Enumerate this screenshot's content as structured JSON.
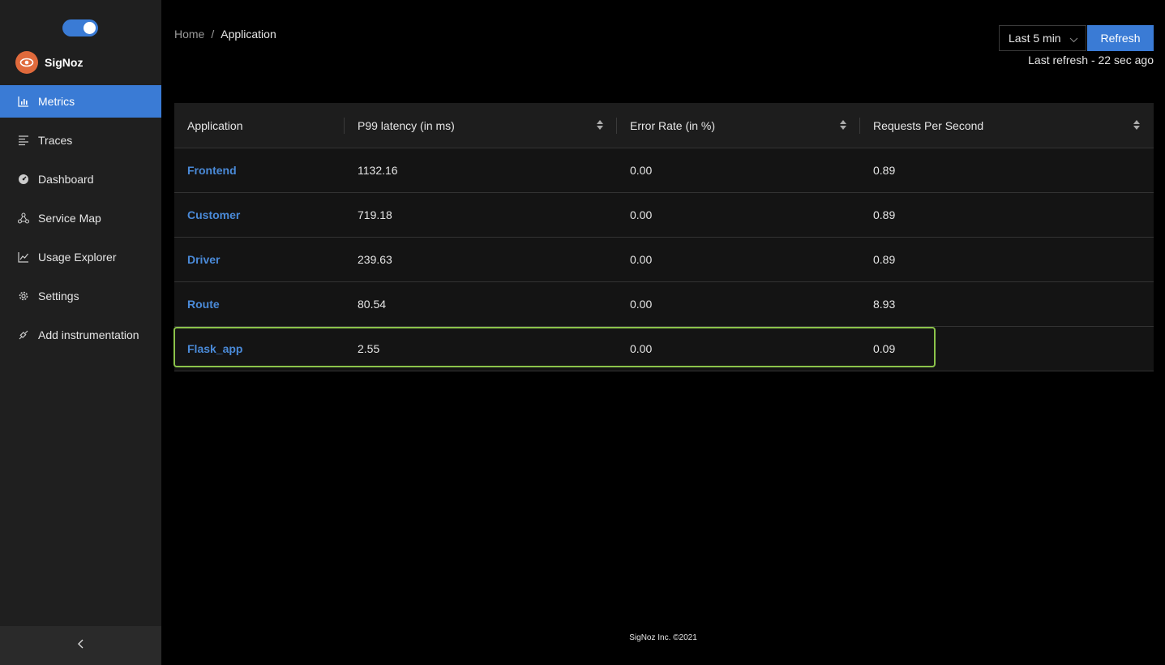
{
  "brand": {
    "name": "SigNoz",
    "logo_icon": "eye-logo-icon",
    "accent": "#e06a3c"
  },
  "sidebar": {
    "items": [
      {
        "label": "Metrics",
        "icon": "bar-chart-icon",
        "active": true
      },
      {
        "label": "Traces",
        "icon": "align-left-icon"
      },
      {
        "label": "Dashboard",
        "icon": "dashboard-icon"
      },
      {
        "label": "Service Map",
        "icon": "deployment-unit-icon"
      },
      {
        "label": "Usage Explorer",
        "icon": "line-chart-icon"
      },
      {
        "label": "Settings",
        "icon": "gear-icon"
      },
      {
        "label": "Add instrumentation",
        "icon": "api-icon"
      }
    ],
    "collapse_icon": "chevron-left-icon"
  },
  "breadcrumb": {
    "home": "Home",
    "separator": "/",
    "current": "Application"
  },
  "header": {
    "time_range": "Last 5 min",
    "refresh_label": "Refresh",
    "last_refresh": "Last refresh - 22 sec ago"
  },
  "table": {
    "columns": [
      "Application",
      "P99 latency (in ms)",
      "Error Rate (in %)",
      "Requests Per Second"
    ],
    "rows": [
      {
        "application": "Frontend",
        "p99": "1132.16",
        "error_rate": "0.00",
        "rps": "0.89"
      },
      {
        "application": "Customer",
        "p99": "719.18",
        "error_rate": "0.00",
        "rps": "0.89"
      },
      {
        "application": "Driver",
        "p99": "239.63",
        "error_rate": "0.00",
        "rps": "0.89"
      },
      {
        "application": "Route",
        "p99": "80.54",
        "error_rate": "0.00",
        "rps": "8.93"
      },
      {
        "application": "Flask_app",
        "p99": "2.55",
        "error_rate": "0.00",
        "rps": "0.09"
      }
    ],
    "highlighted_row": "Flask_app",
    "highlight_color": "#8bc34a"
  },
  "footer": {
    "text": "SigNoz Inc. ©2021"
  },
  "colors": {
    "primary": "#3a7bd5",
    "link": "#4a8ad8",
    "sidebar_bg": "#1f1f1f"
  }
}
